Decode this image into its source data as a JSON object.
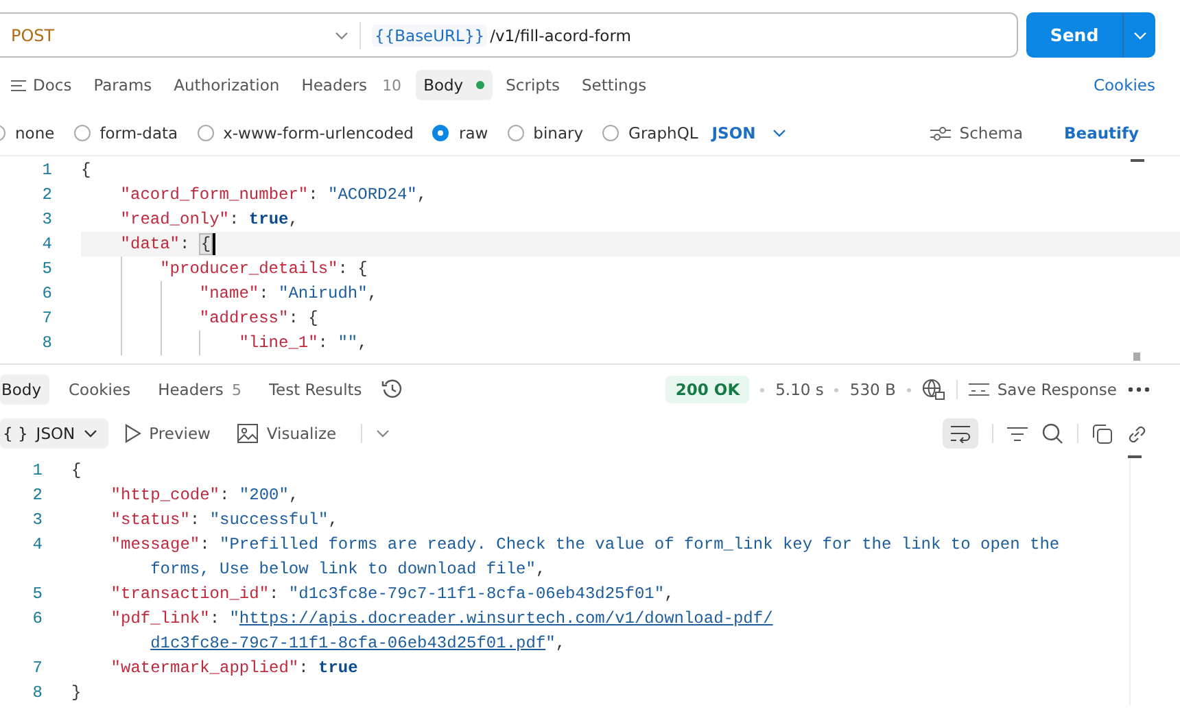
{
  "request": {
    "method": "POST",
    "url_variable": "{{BaseURL}}",
    "url_path": "/v1/fill-acord-form",
    "send_label": "Send"
  },
  "request_tabs": [
    {
      "label": "Docs",
      "kind": "docs",
      "selected": false
    },
    {
      "label": "Params",
      "selected": false
    },
    {
      "label": "Authorization",
      "selected": false
    },
    {
      "label": "Headers",
      "count": "10",
      "selected": false
    },
    {
      "label": "Body",
      "dot": true,
      "selected": true
    },
    {
      "label": "Scripts",
      "selected": false
    },
    {
      "label": "Settings",
      "selected": false
    }
  ],
  "cookies_link": "Cookies",
  "body_types": [
    {
      "label": "none",
      "selected": false
    },
    {
      "label": "form-data",
      "selected": false
    },
    {
      "label": "x-www-form-urlencoded",
      "selected": false
    },
    {
      "label": "raw",
      "selected": true
    },
    {
      "label": "binary",
      "selected": false
    },
    {
      "label": "GraphQL",
      "selected": false
    }
  ],
  "raw_format": "JSON",
  "schema_label": "Schema",
  "beautify_label": "Beautify",
  "request_editor": [
    {
      "number": "1",
      "active": false,
      "tokens": [
        {
          "kind": "punct",
          "text": "{"
        }
      ],
      "children": [
        {
          "number": "2",
          "active": false,
          "tokens": [
            {
              "kind": "key",
              "text": "\"acord_form_number\""
            },
            {
              "kind": "punct",
              "text": ": "
            },
            {
              "kind": "string",
              "text": "\"ACORD24\""
            },
            {
              "kind": "punct",
              "text": ","
            }
          ]
        },
        {
          "number": "3",
          "active": false,
          "tokens": [
            {
              "kind": "key",
              "text": "\"read_only\""
            },
            {
              "kind": "punct",
              "text": ": "
            },
            {
              "kind": "keyword",
              "text": "true"
            },
            {
              "kind": "punct",
              "text": ","
            }
          ]
        },
        {
          "number": "4",
          "active": true,
          "tokens": [
            {
              "kind": "key",
              "text": "\"data\""
            },
            {
              "kind": "punct",
              "text": ": "
            },
            {
              "kind": "match",
              "text": "{"
            }
          ],
          "children": [
            {
              "number": "5",
              "active": false,
              "tokens": [
                {
                  "kind": "key",
                  "text": "\"producer_details\""
                },
                {
                  "kind": "punct",
                  "text": ": {"
                }
              ],
              "children": [
                {
                  "number": "6",
                  "active": false,
                  "tokens": [
                    {
                      "kind": "key",
                      "text": "\"name\""
                    },
                    {
                      "kind": "punct",
                      "text": ": "
                    },
                    {
                      "kind": "string",
                      "text": "\"Anirudh\""
                    },
                    {
                      "kind": "punct",
                      "text": ","
                    }
                  ]
                },
                {
                  "number": "7",
                  "active": false,
                  "tokens": [
                    {
                      "kind": "key",
                      "text": "\"address\""
                    },
                    {
                      "kind": "punct",
                      "text": ": {"
                    }
                  ],
                  "children": [
                    {
                      "number": "8",
                      "active": false,
                      "tokens": [
                        {
                          "kind": "key",
                          "text": "\"line_1\""
                        },
                        {
                          "kind": "punct",
                          "text": ": "
                        },
                        {
                          "kind": "string",
                          "text": "\"\""
                        },
                        {
                          "kind": "punct",
                          "text": ","
                        }
                      ]
                    }
                  ]
                }
              ]
            }
          ]
        }
      ]
    }
  ],
  "response_tabs": [
    {
      "label": "Body",
      "selected": true
    },
    {
      "label": "Cookies",
      "selected": false
    },
    {
      "label": "Headers",
      "count": "5",
      "selected": false
    },
    {
      "label": "Test Results",
      "selected": false
    }
  ],
  "response_status": {
    "code": "200 OK",
    "time": "5.10 s",
    "size": "530 B",
    "save_label": "Save Response"
  },
  "response_views": [
    {
      "label": "JSON",
      "kind": "format",
      "selected": true
    },
    {
      "label": "Preview",
      "kind": "preview",
      "selected": false
    },
    {
      "label": "Visualize",
      "kind": "visualize",
      "selected": false
    }
  ],
  "format_glyph": "{ }",
  "wrap_lines": true,
  "response_body": [
    {
      "number": "1",
      "tokens": [
        {
          "kind": "punct",
          "text": "{"
        }
      ],
      "children": [
        {
          "number": "2",
          "tokens": [
            {
              "kind": "key",
              "text": "\"http_code\""
            },
            {
              "kind": "punct",
              "text": ": "
            },
            {
              "kind": "string",
              "text": "\"200\""
            },
            {
              "kind": "punct",
              "text": ","
            }
          ]
        },
        {
          "number": "3",
          "tokens": [
            {
              "kind": "key",
              "text": "\"status\""
            },
            {
              "kind": "punct",
              "text": ": "
            },
            {
              "kind": "string",
              "text": "\"successful\""
            },
            {
              "kind": "punct",
              "text": ","
            }
          ]
        },
        {
          "number": "4",
          "tokens": [
            {
              "kind": "key",
              "text": "\"message\""
            },
            {
              "kind": "punct",
              "text": ": "
            },
            {
              "kind": "string",
              "text": "\"Prefilled forms are ready. Check the value of form_link key for the link to open the"
            }
          ],
          "wrapped": [
            {
              "kind": "string",
              "text": "forms, Use below link to download file\""
            },
            {
              "kind": "punct",
              "text": ","
            }
          ]
        },
        {
          "number": "5",
          "tokens": [
            {
              "kind": "key",
              "text": "\"transaction_id\""
            },
            {
              "kind": "punct",
              "text": ": "
            },
            {
              "kind": "string",
              "text": "\"d1c3fc8e-79c7-11f1-8cfa-06eb43d25f01\""
            },
            {
              "kind": "punct",
              "text": ","
            }
          ]
        },
        {
          "number": "6",
          "tokens": [
            {
              "kind": "key",
              "text": "\"pdf_link\""
            },
            {
              "kind": "punct",
              "text": ": "
            },
            {
              "kind": "string",
              "text": "\""
            },
            {
              "kind": "link",
              "text": "https://apis.docreader.winsurtech.com/v1/download-pdf/"
            }
          ],
          "wrapped": [
            {
              "kind": "link",
              "text": "d1c3fc8e-79c7-11f1-8cfa-06eb43d25f01.pdf"
            },
            {
              "kind": "string",
              "text": "\""
            },
            {
              "kind": "punct",
              "text": ","
            }
          ]
        },
        {
          "number": "7",
          "tokens": [
            {
              "kind": "key",
              "text": "\"watermark_applied\""
            },
            {
              "kind": "punct",
              "text": ": "
            },
            {
              "kind": "keyword",
              "text": "true"
            }
          ]
        }
      ]
    },
    {
      "number": "8",
      "tokens": [
        {
          "kind": "punct",
          "text": "}"
        }
      ]
    }
  ]
}
